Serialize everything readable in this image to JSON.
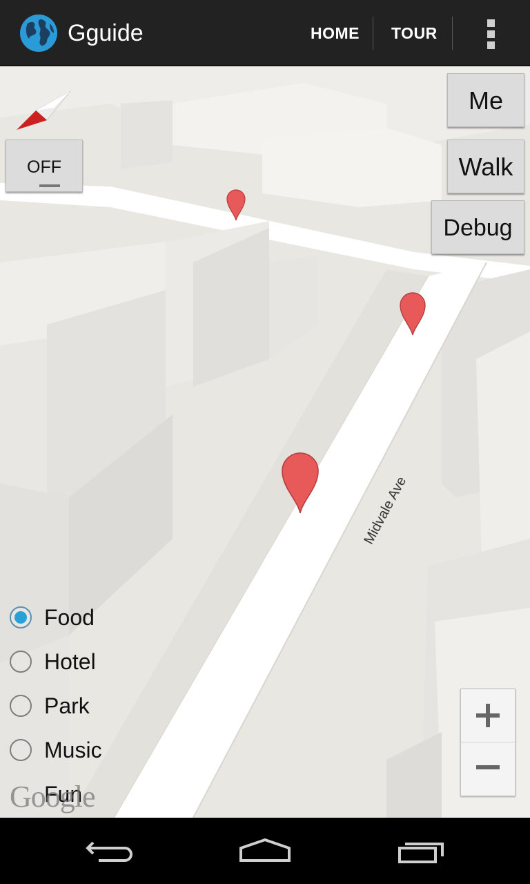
{
  "app": {
    "title": "Gguide",
    "icon": "globe-icon",
    "actions": [
      "HOME",
      "TOUR"
    ],
    "overflow_icon": "overflow-menu-icon"
  },
  "map": {
    "street_label": "Midvale Ave",
    "compass_icon": "compass-icon",
    "toggle_label": "OFF",
    "buttons": {
      "me": "Me",
      "walk": "Walk",
      "debug": "Debug"
    },
    "markers": [
      "map-pin-icon",
      "map-pin-icon",
      "map-pin-icon"
    ],
    "categories": [
      {
        "label": "Food",
        "selected": true
      },
      {
        "label": "Hotel",
        "selected": false
      },
      {
        "label": "Park",
        "selected": false
      },
      {
        "label": "Music",
        "selected": false
      },
      {
        "label": "Fun",
        "selected": false
      }
    ],
    "attribution": "Google",
    "zoom": {
      "in_icon": "plus-icon",
      "out_icon": "minus-icon"
    }
  },
  "navbar": {
    "back_icon": "back-icon",
    "home_icon": "home-icon",
    "recents_icon": "recents-icon"
  },
  "colors": {
    "actionbar": "#222222",
    "accent": "#2aa0d8",
    "marker": "#e8595a",
    "map_ground": "#e9e7e2"
  }
}
